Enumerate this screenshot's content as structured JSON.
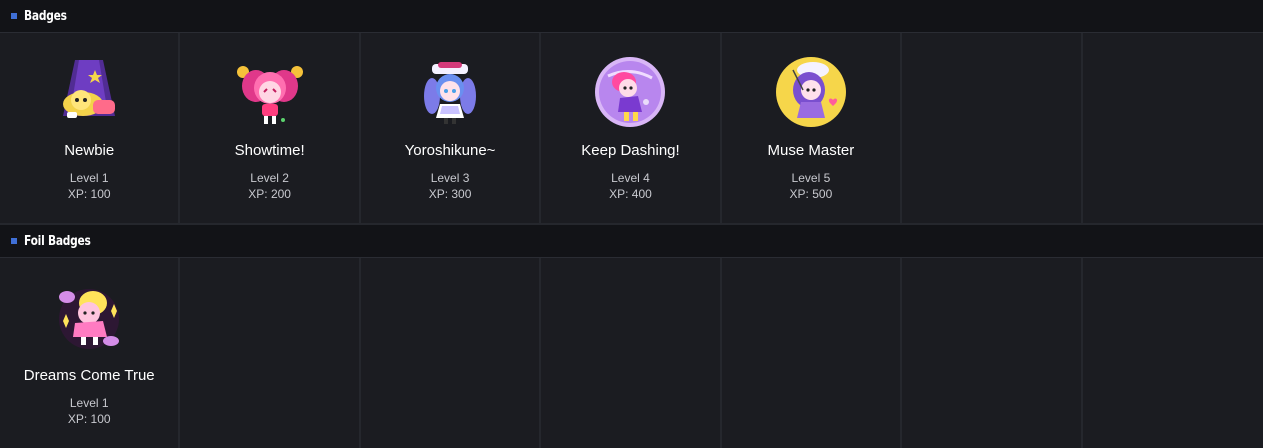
{
  "sections": [
    {
      "title": "Badges",
      "badges": [
        {
          "name": "Newbie",
          "level": "Level 1",
          "xp": "XP: 100",
          "icon": "newbie-badge-icon"
        },
        {
          "name": "Showtime!",
          "level": "Level 2",
          "xp": "XP: 200",
          "icon": "showtime-badge-icon"
        },
        {
          "name": "Yoroshikune~",
          "level": "Level 3",
          "xp": "XP: 300",
          "icon": "yoroshikune-badge-icon"
        },
        {
          "name": "Keep Dashing!",
          "level": "Level 4",
          "xp": "XP: 400",
          "icon": "keep-dashing-badge-icon"
        },
        {
          "name": "Muse Master",
          "level": "Level 5",
          "xp": "XP: 500",
          "icon": "muse-master-badge-icon"
        }
      ]
    },
    {
      "title": "Foil Badges",
      "badges": [
        {
          "name": "Dreams Come True",
          "level": "Level 1",
          "xp": "XP: 100",
          "icon": "dreams-come-true-badge-icon"
        }
      ]
    }
  ],
  "colors": {
    "accent": "#3f6fd6",
    "header_bg": "#121317",
    "panel_bg": "#1b1c21"
  }
}
